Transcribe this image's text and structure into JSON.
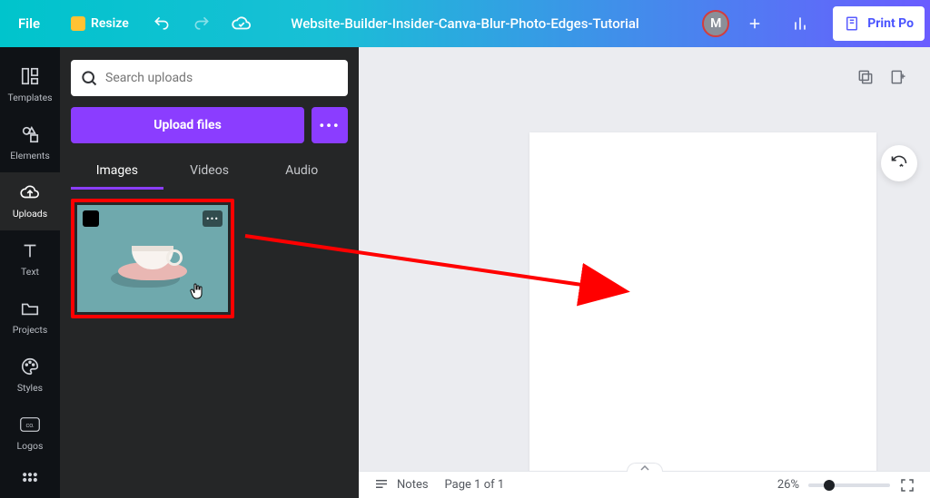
{
  "topbar": {
    "file": "File",
    "resize": "Resize",
    "title": "Website-Builder-Insider-Canva-Blur-Photo-Edges-Tutorial",
    "avatar_initial": "M",
    "print": "Print Po"
  },
  "rail": {
    "templates": "Templates",
    "elements": "Elements",
    "uploads": "Uploads",
    "text": "Text",
    "projects": "Projects",
    "styles": "Styles",
    "logos": "Logos",
    "co_badge": "CO."
  },
  "panel": {
    "search_placeholder": "Search uploads",
    "upload": "Upload files",
    "tabs": {
      "images": "Images",
      "videos": "Videos",
      "audio": "Audio"
    },
    "thumb_more": "•••"
  },
  "status": {
    "notes": "Notes",
    "page_indicator": "Page 1 of 1",
    "zoom_pct": "26%",
    "zoom_position_pct": 26
  }
}
